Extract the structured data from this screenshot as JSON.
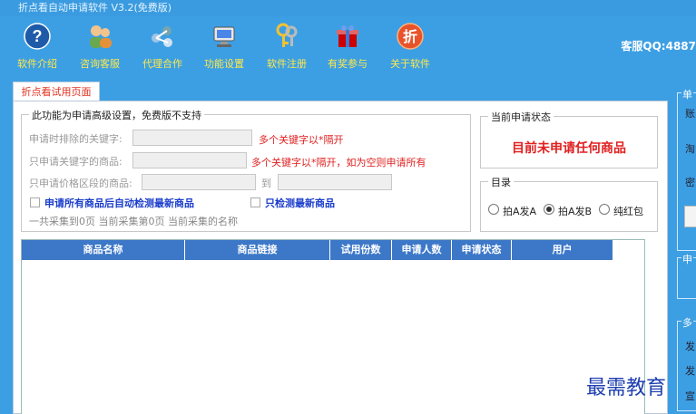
{
  "window": {
    "title": "折点看自动申请软件 V3.2(免费版)"
  },
  "toolbar": {
    "items": [
      {
        "label": "软件介绍",
        "icon": "help-icon"
      },
      {
        "label": "咨询客服",
        "icon": "users-icon"
      },
      {
        "label": "代理合作",
        "icon": "network-icon"
      },
      {
        "label": "功能设置",
        "icon": "settings-icon"
      },
      {
        "label": "软件注册",
        "icon": "keys-icon"
      },
      {
        "label": "有奖参与",
        "icon": "gift-icon"
      },
      {
        "label": "关于软件",
        "icon": "discount-icon"
      }
    ],
    "service_label": "客服QQ:4887"
  },
  "tab": {
    "label": "折点看试用页面"
  },
  "advanced": {
    "legend": "此功能为申请高级设置，免费版不支持",
    "exclude_keyword_label": "申请时排除的关键字:",
    "exclude_keyword_value": "",
    "exclude_keyword_hint": "多个关键字以*隔开",
    "include_keyword_label": "只申请关键字的商品:",
    "include_keyword_value": "",
    "include_keyword_hint": "多个关键字以*隔开，如为空则申请所有",
    "price_label": "只申请价格区段的商品:",
    "price_min": "",
    "price_to": "到",
    "price_max": "",
    "auto_detect_label": "申请所有商品后自动检测最新商品",
    "only_newest_label": "只检测最新商品",
    "progress_text": "一共采集到0页  当前采集第0页  当前采集的名称"
  },
  "status": {
    "legend": "当前申请状态",
    "text": "目前未申请任何商品"
  },
  "catalog": {
    "legend": "目录",
    "options": [
      "拍A发A",
      "拍A发B",
      "纯红包"
    ],
    "selected": "拍A发B"
  },
  "table": {
    "columns": [
      "商品名称",
      "商品链接",
      "试用份数",
      "申请人数",
      "申请状态",
      "用户"
    ],
    "rows": []
  },
  "right_panel": {
    "legend_top": "单",
    "labels": [
      "账",
      "淘",
      "密"
    ],
    "legend_mid": "申",
    "legend_bottom": "多",
    "bottom_texts": [
      "发",
      "发",
      "宣"
    ]
  },
  "watermark": "最需教育",
  "colors": {
    "accent": "#3d9fe3",
    "tool_label": "#ffe94a",
    "warning": "#e02020",
    "header": "#3d78c8"
  }
}
